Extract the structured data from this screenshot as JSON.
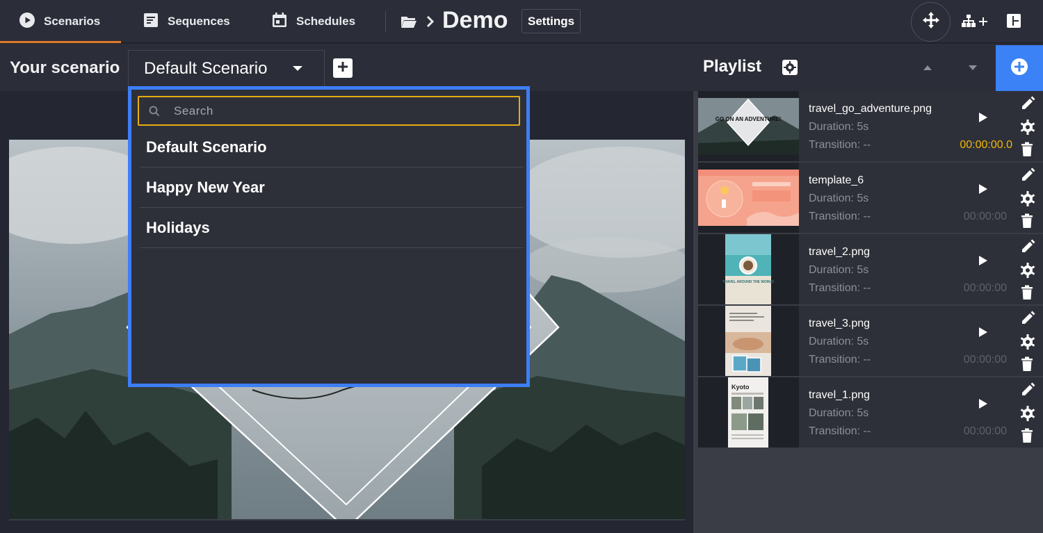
{
  "nav": {
    "tabs": [
      {
        "label": "Scenarios",
        "icon": "play-circle-icon",
        "active": true
      },
      {
        "label": "Sequences",
        "icon": "sequence-list-icon",
        "active": false
      },
      {
        "label": "Schedules",
        "icon": "calendar-icon",
        "active": false
      }
    ],
    "project_title": "Demo",
    "settings_label": "Settings"
  },
  "scenario": {
    "label": "Your scenario",
    "selected": "Default Scenario"
  },
  "dropdown": {
    "search_placeholder": "Search",
    "items": [
      "Default Scenario",
      "Happy New Year",
      "Holidays"
    ]
  },
  "playlist": {
    "title": "Playlist",
    "items": [
      {
        "name": "travel_go_adventure.png",
        "duration": "Duration: 5s",
        "transition": "Transition: --",
        "time": "00:00:00.0",
        "active": true
      },
      {
        "name": "template_6",
        "duration": "Duration: 5s",
        "transition": "Transition: --",
        "time": "00:00:00",
        "active": false
      },
      {
        "name": "travel_2.png",
        "duration": "Duration: 5s",
        "transition": "Transition: --",
        "time": "00:00:00",
        "active": false
      },
      {
        "name": "travel_3.png",
        "duration": "Duration: 5s",
        "transition": "Transition: --",
        "time": "00:00:00",
        "active": false
      },
      {
        "name": "travel_1.png",
        "duration": "Duration: 5s",
        "transition": "Transition: --",
        "time": "00:00:00",
        "active": false
      }
    ]
  },
  "thumbs": {
    "adventure_text": "GO ON AN ADVENTURE!",
    "travel2_text": "TRAVEL AROUND THE WORLD",
    "kyoto_text": "Kyoto"
  },
  "colors": {
    "accent_orange": "#e07b2a",
    "focus_blue": "#3d7ef7",
    "search_border": "#e6ad13",
    "add_button_blue": "#3b82f6",
    "time_active": "#f0b90b"
  }
}
